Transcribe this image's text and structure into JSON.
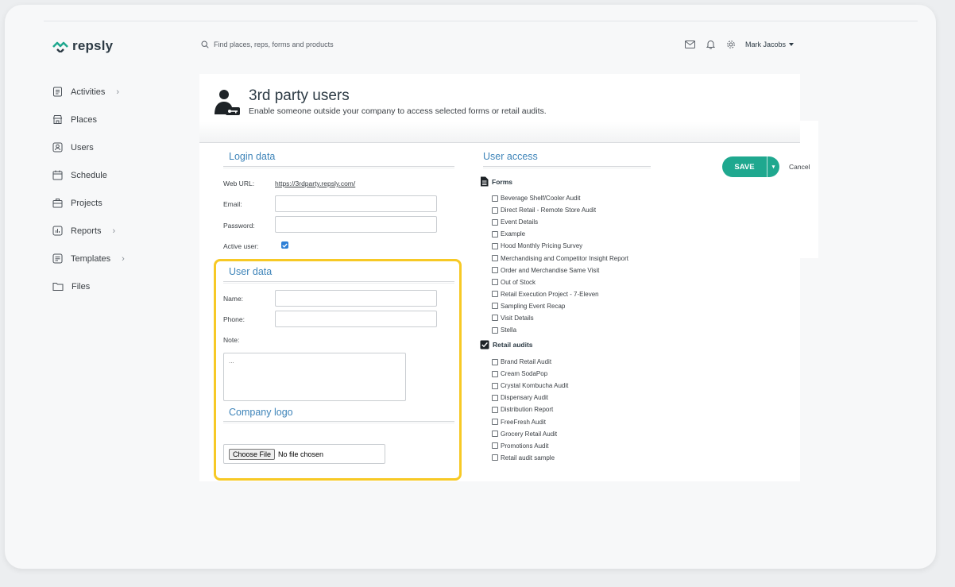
{
  "brand": {
    "name": "repsly",
    "accent": "#1fa88f",
    "link_color": "#3e84b9",
    "highlight": "#f7c925"
  },
  "search": {
    "placeholder": "Find places, reps, forms and products",
    "icon": "search-icon"
  },
  "header": {
    "icons": [
      "mail-icon",
      "bell-icon",
      "gear-icon"
    ],
    "user_name": "Mark Jacobs"
  },
  "nav": {
    "items": [
      {
        "label": "Activities",
        "icon": "activities-icon",
        "has_chevron": true
      },
      {
        "label": "Places",
        "icon": "store-icon",
        "has_chevron": false
      },
      {
        "label": "Users",
        "icon": "user-icon",
        "has_chevron": false
      },
      {
        "label": "Schedule",
        "icon": "calendar-icon",
        "has_chevron": false
      },
      {
        "label": "Projects",
        "icon": "projects-icon",
        "has_chevron": false
      },
      {
        "label": "Reports",
        "icon": "chart-icon",
        "has_chevron": true
      },
      {
        "label": "Templates",
        "icon": "templates-icon",
        "has_chevron": true
      },
      {
        "label": "Files",
        "icon": "folder-icon",
        "has_chevron": false
      }
    ],
    "chevron": "›"
  },
  "page": {
    "title": "3rd party users",
    "subtitle": "Enable someone outside your company to access selected forms or retail audits."
  },
  "login": {
    "title": "Login data",
    "web_url_label": "Web URL:",
    "web_url": "https://3rdparty.repsly.com/",
    "email_label": "Email:",
    "email_value": "",
    "password_label": "Password:",
    "password_value": "",
    "active_label": "Active user:",
    "active_checked": true
  },
  "user_data": {
    "title": "User data",
    "name_label": "Name:",
    "name_value": "",
    "phone_label": "Phone:",
    "phone_value": "",
    "note_label": "Note:",
    "note_placeholder": "..."
  },
  "company_logo": {
    "title": "Company logo",
    "button_label": "Choose File",
    "status": "No file chosen"
  },
  "access": {
    "title": "User access",
    "forms_label": "Forms",
    "forms": [
      "Beverage Shelf/Cooler Audit",
      "Direct Retail - Remote Store Audit",
      "Event Details",
      "Example",
      "Hood Monthly Pricing Survey",
      "Merchandising and Competitor Insight Report",
      "Order and Merchandise Same Visit",
      "Out of Stock",
      "Retail Execution Project - 7-Eleven",
      "Sampling Event Recap",
      "Visit Details",
      "Stella"
    ],
    "audits_label": "Retail audits",
    "audits": [
      "Brand Retail Audit",
      "Cream SodaPop",
      "Crystal Kombucha Audit",
      "Dispensary Audit",
      "Distribution Report",
      "FreeFresh Audit",
      "Grocery Retail Audit",
      "Promotions Audit",
      "Retail audit sample"
    ]
  },
  "actions": {
    "save_label": "SAVE",
    "dropdown_glyph": "▾",
    "cancel_label": "Cancel"
  }
}
